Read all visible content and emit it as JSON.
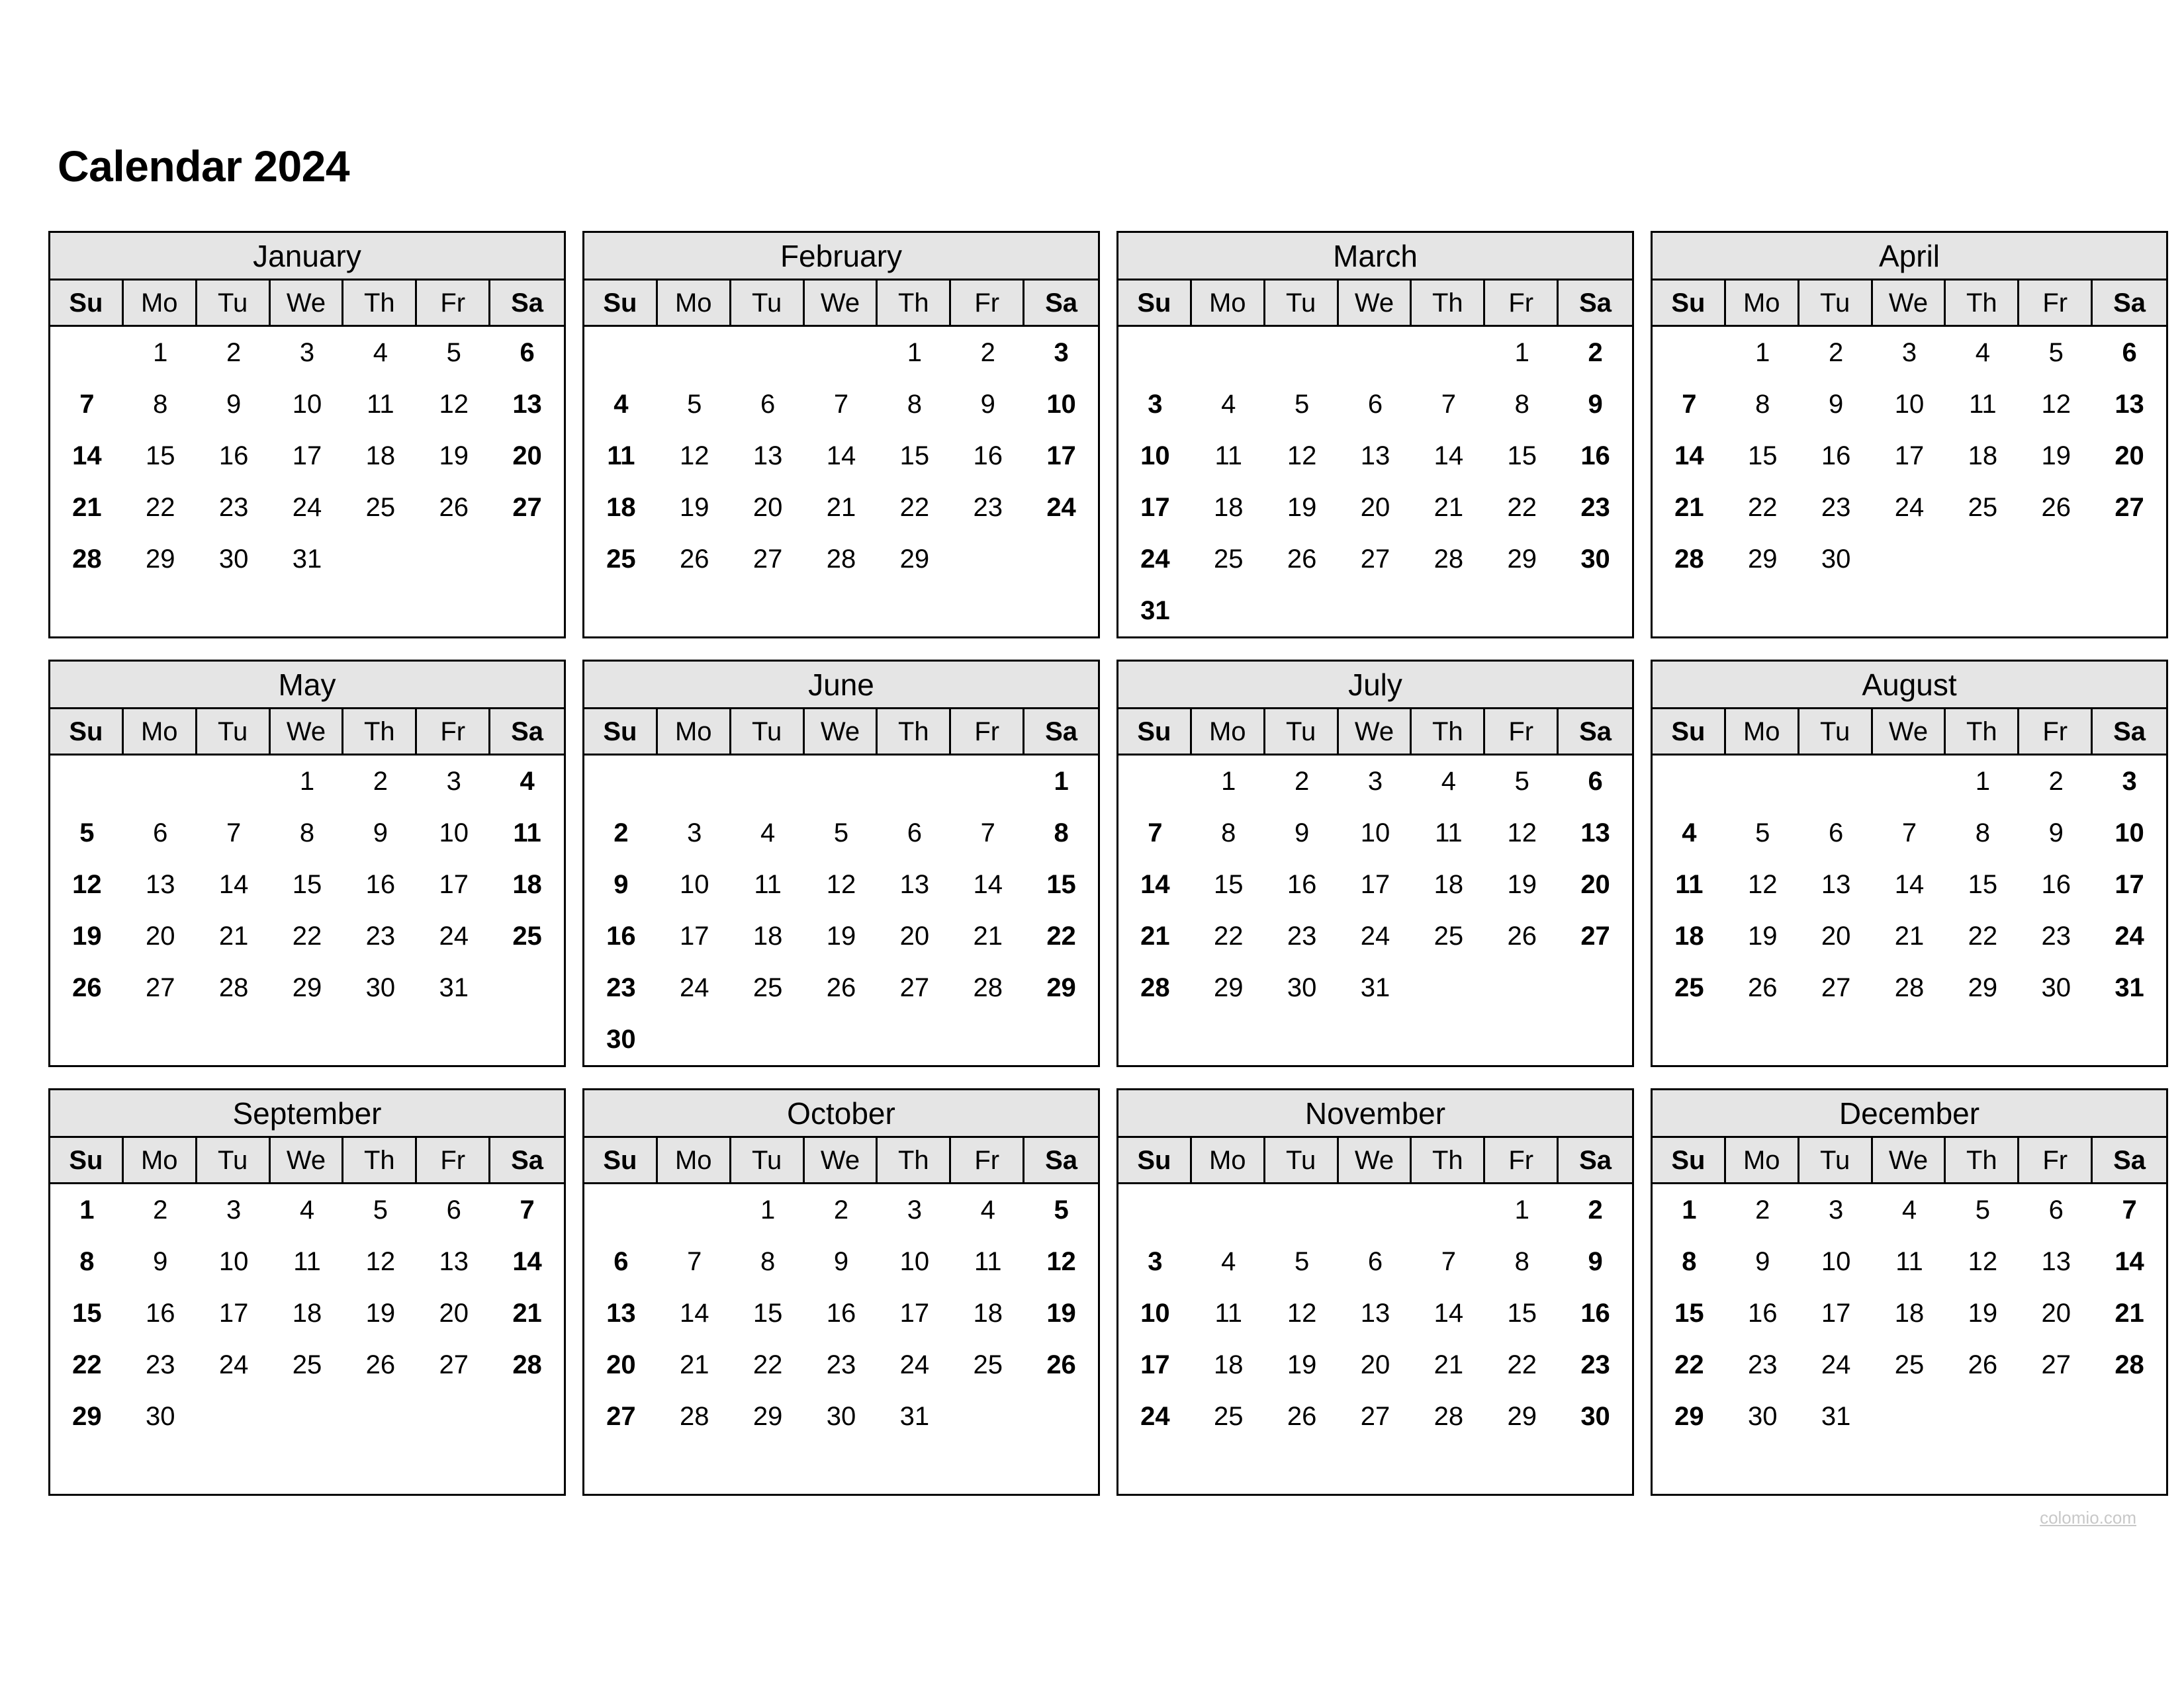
{
  "page": {
    "title": "Calendar 2024",
    "year": "2024",
    "watermark": "colomio.com",
    "header_bg": "#e5e5e5",
    "border_color": "#000000",
    "background": "#ffffff",
    "watermark_color": "#c8c8c8"
  },
  "weekday_headers": [
    "Su",
    "Mo",
    "Tu",
    "We",
    "Th",
    "Fr",
    "Sa"
  ],
  "weekend_columns": [
    0,
    6
  ],
  "months": [
    {
      "name": "January",
      "weeks": [
        [
          "",
          "1",
          "2",
          "3",
          "4",
          "5",
          "6"
        ],
        [
          "7",
          "8",
          "9",
          "10",
          "11",
          "12",
          "13"
        ],
        [
          "14",
          "15",
          "16",
          "17",
          "18",
          "19",
          "20"
        ],
        [
          "21",
          "22",
          "23",
          "24",
          "25",
          "26",
          "27"
        ],
        [
          "28",
          "29",
          "30",
          "31",
          "",
          "",
          ""
        ],
        [
          "",
          "",
          "",
          "",
          "",
          "",
          ""
        ]
      ]
    },
    {
      "name": "February",
      "weeks": [
        [
          "",
          "",
          "",
          "",
          "1",
          "2",
          "3"
        ],
        [
          "4",
          "5",
          "6",
          "7",
          "8",
          "9",
          "10"
        ],
        [
          "11",
          "12",
          "13",
          "14",
          "15",
          "16",
          "17"
        ],
        [
          "18",
          "19",
          "20",
          "21",
          "22",
          "23",
          "24"
        ],
        [
          "25",
          "26",
          "27",
          "28",
          "29",
          "",
          ""
        ],
        [
          "",
          "",
          "",
          "",
          "",
          "",
          ""
        ]
      ]
    },
    {
      "name": "March",
      "weeks": [
        [
          "",
          "",
          "",
          "",
          "",
          "1",
          "2"
        ],
        [
          "3",
          "4",
          "5",
          "6",
          "7",
          "8",
          "9"
        ],
        [
          "10",
          "11",
          "12",
          "13",
          "14",
          "15",
          "16"
        ],
        [
          "17",
          "18",
          "19",
          "20",
          "21",
          "22",
          "23"
        ],
        [
          "24",
          "25",
          "26",
          "27",
          "28",
          "29",
          "30"
        ],
        [
          "31",
          "",
          "",
          "",
          "",
          "",
          ""
        ]
      ]
    },
    {
      "name": "April",
      "weeks": [
        [
          "",
          "1",
          "2",
          "3",
          "4",
          "5",
          "6"
        ],
        [
          "7",
          "8",
          "9",
          "10",
          "11",
          "12",
          "13"
        ],
        [
          "14",
          "15",
          "16",
          "17",
          "18",
          "19",
          "20"
        ],
        [
          "21",
          "22",
          "23",
          "24",
          "25",
          "26",
          "27"
        ],
        [
          "28",
          "29",
          "30",
          "",
          "",
          "",
          ""
        ],
        [
          "",
          "",
          "",
          "",
          "",
          "",
          ""
        ]
      ]
    },
    {
      "name": "May",
      "weeks": [
        [
          "",
          "",
          "",
          "1",
          "2",
          "3",
          "4"
        ],
        [
          "5",
          "6",
          "7",
          "8",
          "9",
          "10",
          "11"
        ],
        [
          "12",
          "13",
          "14",
          "15",
          "16",
          "17",
          "18"
        ],
        [
          "19",
          "20",
          "21",
          "22",
          "23",
          "24",
          "25"
        ],
        [
          "26",
          "27",
          "28",
          "29",
          "30",
          "31",
          ""
        ],
        [
          "",
          "",
          "",
          "",
          "",
          "",
          ""
        ]
      ]
    },
    {
      "name": "June",
      "weeks": [
        [
          "",
          "",
          "",
          "",
          "",
          "",
          "1"
        ],
        [
          "2",
          "3",
          "4",
          "5",
          "6",
          "7",
          "8"
        ],
        [
          "9",
          "10",
          "11",
          "12",
          "13",
          "14",
          "15"
        ],
        [
          "16",
          "17",
          "18",
          "19",
          "20",
          "21",
          "22"
        ],
        [
          "23",
          "24",
          "25",
          "26",
          "27",
          "28",
          "29"
        ],
        [
          "30",
          "",
          "",
          "",
          "",
          "",
          ""
        ]
      ]
    },
    {
      "name": "July",
      "weeks": [
        [
          "",
          "1",
          "2",
          "3",
          "4",
          "5",
          "6"
        ],
        [
          "7",
          "8",
          "9",
          "10",
          "11",
          "12",
          "13"
        ],
        [
          "14",
          "15",
          "16",
          "17",
          "18",
          "19",
          "20"
        ],
        [
          "21",
          "22",
          "23",
          "24",
          "25",
          "26",
          "27"
        ],
        [
          "28",
          "29",
          "30",
          "31",
          "",
          "",
          ""
        ],
        [
          "",
          "",
          "",
          "",
          "",
          "",
          ""
        ]
      ]
    },
    {
      "name": "August",
      "weeks": [
        [
          "",
          "",
          "",
          "",
          "1",
          "2",
          "3"
        ],
        [
          "4",
          "5",
          "6",
          "7",
          "8",
          "9",
          "10"
        ],
        [
          "11",
          "12",
          "13",
          "14",
          "15",
          "16",
          "17"
        ],
        [
          "18",
          "19",
          "20",
          "21",
          "22",
          "23",
          "24"
        ],
        [
          "25",
          "26",
          "27",
          "28",
          "29",
          "30",
          "31"
        ],
        [
          "",
          "",
          "",
          "",
          "",
          "",
          ""
        ]
      ]
    },
    {
      "name": "September",
      "weeks": [
        [
          "1",
          "2",
          "3",
          "4",
          "5",
          "6",
          "7"
        ],
        [
          "8",
          "9",
          "10",
          "11",
          "12",
          "13",
          "14"
        ],
        [
          "15",
          "16",
          "17",
          "18",
          "19",
          "20",
          "21"
        ],
        [
          "22",
          "23",
          "24",
          "25",
          "26",
          "27",
          "28"
        ],
        [
          "29",
          "30",
          "",
          "",
          "",
          "",
          ""
        ],
        [
          "",
          "",
          "",
          "",
          "",
          "",
          ""
        ]
      ]
    },
    {
      "name": "October",
      "weeks": [
        [
          "",
          "",
          "1",
          "2",
          "3",
          "4",
          "5"
        ],
        [
          "6",
          "7",
          "8",
          "9",
          "10",
          "11",
          "12"
        ],
        [
          "13",
          "14",
          "15",
          "16",
          "17",
          "18",
          "19"
        ],
        [
          "20",
          "21",
          "22",
          "23",
          "24",
          "25",
          "26"
        ],
        [
          "27",
          "28",
          "29",
          "30",
          "31",
          "",
          ""
        ],
        [
          "",
          "",
          "",
          "",
          "",
          "",
          ""
        ]
      ]
    },
    {
      "name": "November",
      "weeks": [
        [
          "",
          "",
          "",
          "",
          "",
          "1",
          "2"
        ],
        [
          "3",
          "4",
          "5",
          "6",
          "7",
          "8",
          "9"
        ],
        [
          "10",
          "11",
          "12",
          "13",
          "14",
          "15",
          "16"
        ],
        [
          "17",
          "18",
          "19",
          "20",
          "21",
          "22",
          "23"
        ],
        [
          "24",
          "25",
          "26",
          "27",
          "28",
          "29",
          "30"
        ],
        [
          "",
          "",
          "",
          "",
          "",
          "",
          ""
        ]
      ]
    },
    {
      "name": "December",
      "weeks": [
        [
          "1",
          "2",
          "3",
          "4",
          "5",
          "6",
          "7"
        ],
        [
          "8",
          "9",
          "10",
          "11",
          "12",
          "13",
          "14"
        ],
        [
          "15",
          "16",
          "17",
          "18",
          "19",
          "20",
          "21"
        ],
        [
          "22",
          "23",
          "24",
          "25",
          "26",
          "27",
          "28"
        ],
        [
          "29",
          "30",
          "31",
          "",
          "",
          "",
          ""
        ],
        [
          "",
          "",
          "",
          "",
          "",
          "",
          ""
        ]
      ]
    }
  ]
}
